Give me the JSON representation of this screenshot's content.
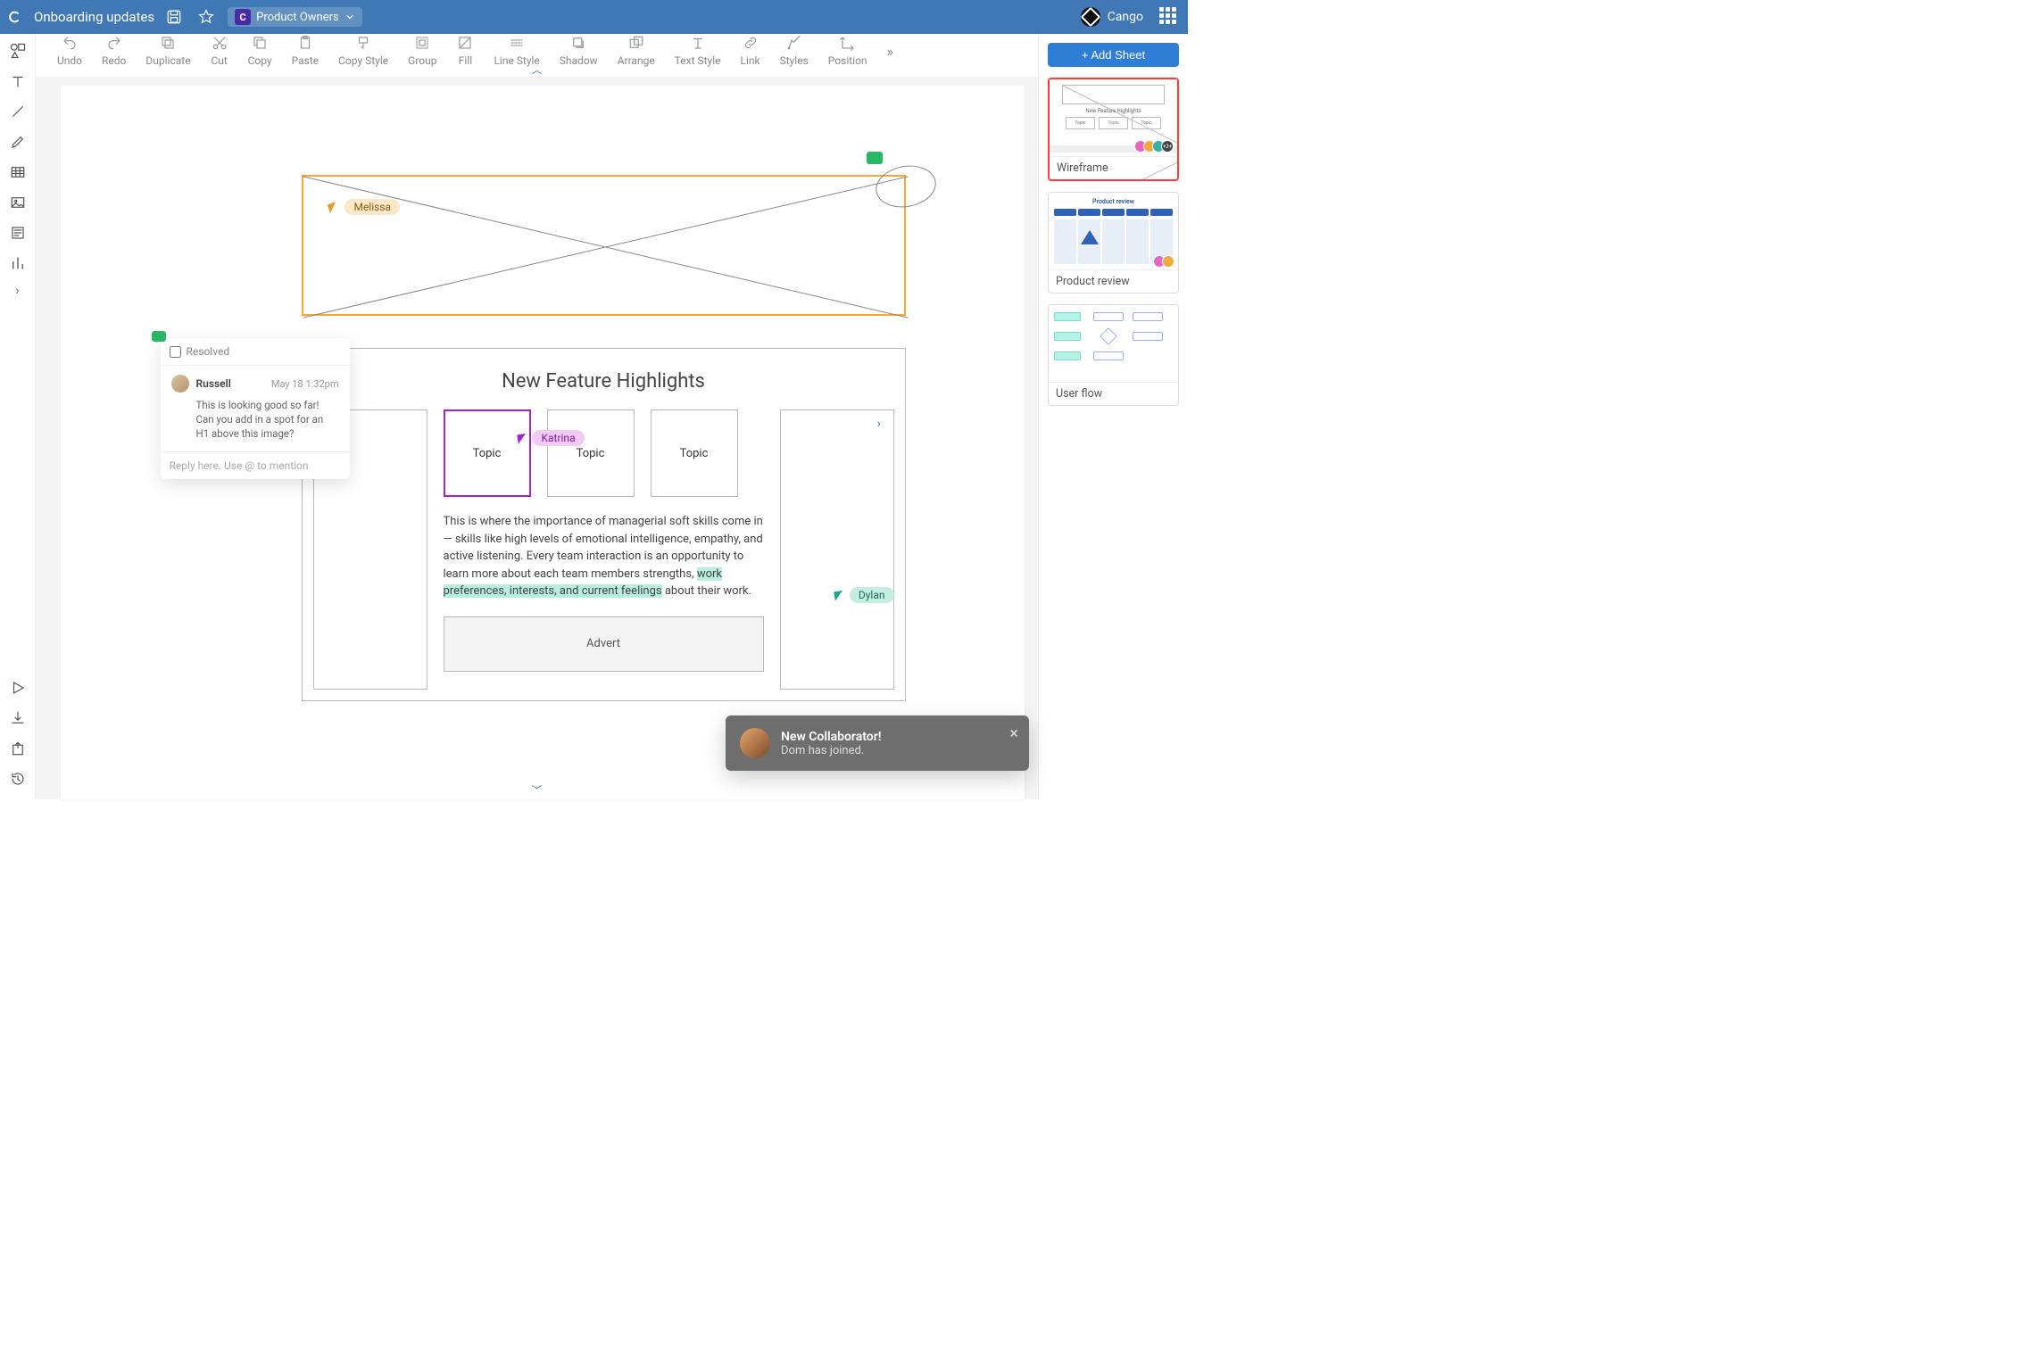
{
  "header": {
    "doc_title": "Onboarding updates",
    "team_name": "Product Owners",
    "brand": "Cango"
  },
  "toolbar": {
    "undo": "Undo",
    "redo": "Redo",
    "duplicate": "Duplicate",
    "cut": "Cut",
    "copy": "Copy",
    "paste": "Paste",
    "copy_style": "Copy Style",
    "group": "Group",
    "fill": "Fill",
    "line_style": "Line Style",
    "shadow": "Shadow",
    "arrange": "Arrange",
    "text_style": "Text Style",
    "link": "Link",
    "styles": "Styles",
    "position": "Position"
  },
  "cursors": {
    "melissa": "Melissa",
    "katrina": "Katrina",
    "dylan": "Dylan"
  },
  "canvas": {
    "section_title": "New Feature Highlights",
    "topic_label": "Topic",
    "body_pre": "This is where the importance of managerial soft skills come in — skills like high levels of emotional intelligence, empathy, and active listening. Every team interaction is an opportunity to learn more about each team members strengths, ",
    "body_highlight": "work preferences, interests, and current feelings",
    "body_post": " about their work.",
    "advert_label": "Advert"
  },
  "comment": {
    "resolved_label": "Resolved",
    "author": "Russell",
    "timestamp": "May 18 1:32pm",
    "message": "This is looking good so far! Can you add in a spot for an H1 above this image?",
    "reply_placeholder": "Reply here. Use @ to mention"
  },
  "sheets": {
    "add_label": "+ Add Sheet",
    "items": [
      {
        "label": "Wireframe",
        "thumb_title": "New Feature Highlights",
        "thumb_card": "Topic",
        "avatar_overflow": "+2+"
      },
      {
        "label": "Product review",
        "thumb_title": "Product review"
      },
      {
        "label": "User flow"
      }
    ]
  },
  "toast": {
    "title": "New Collaborator!",
    "subtitle": "Dom has joined."
  }
}
